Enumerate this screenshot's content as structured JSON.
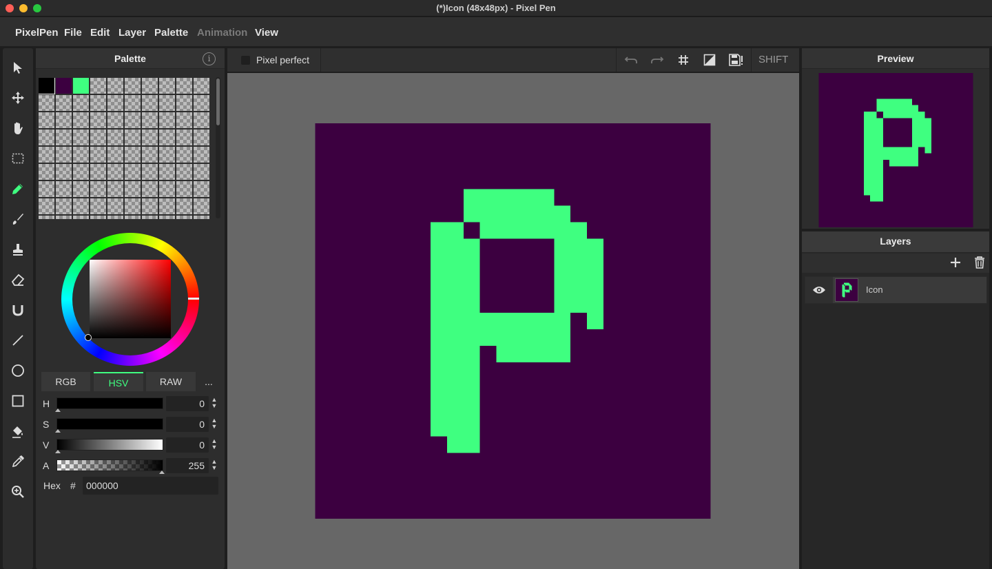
{
  "window": {
    "title": "(*)Icon (48x48px) - Pixel Pen"
  },
  "menu": [
    "PixelPen",
    "File",
    "Edit",
    "Layer",
    "Palette",
    "Animation",
    "View"
  ],
  "menu_disabled": [
    "Animation"
  ],
  "tools": [
    "select-icon",
    "move-icon",
    "hand-icon",
    "marquee-icon",
    "pencil-icon",
    "brush-icon",
    "stamp-icon",
    "eraser-icon",
    "magnet-icon",
    "line-icon",
    "ellipse-icon",
    "rectangle-icon",
    "bucket-icon",
    "eyedropper-icon",
    "zoom-icon"
  ],
  "palette": {
    "title": "Palette",
    "colors": [
      "#000000",
      "#3c0040",
      "#3fff80"
    ],
    "selected_index": 0,
    "tabs": [
      "RGB",
      "HSV",
      "RAW",
      "..."
    ],
    "active_tab": "HSV",
    "sliders": [
      {
        "label": "H",
        "value": "0"
      },
      {
        "label": "S",
        "value": "0"
      },
      {
        "label": "V",
        "value": "0"
      },
      {
        "label": "A",
        "value": "255"
      }
    ],
    "hex_label": "Hex",
    "hex_hash": "#",
    "hex_value": "000000"
  },
  "canvas_toolbar": {
    "pixel_perfect_label": "Pixel perfect",
    "pixel_perfect_checked": false,
    "shift_label": "SHIFT"
  },
  "canvas": {
    "background": "#3c0040",
    "foreground": "#3fff80",
    "size": "48x48px"
  },
  "preview": {
    "title": "Preview"
  },
  "layers": {
    "title": "Layers",
    "items": [
      {
        "name": "Icon",
        "visible": true
      }
    ]
  },
  "colors": {
    "accent": "#3fff80",
    "ink": "#3c0040",
    "panel": "#2d2d2d"
  }
}
